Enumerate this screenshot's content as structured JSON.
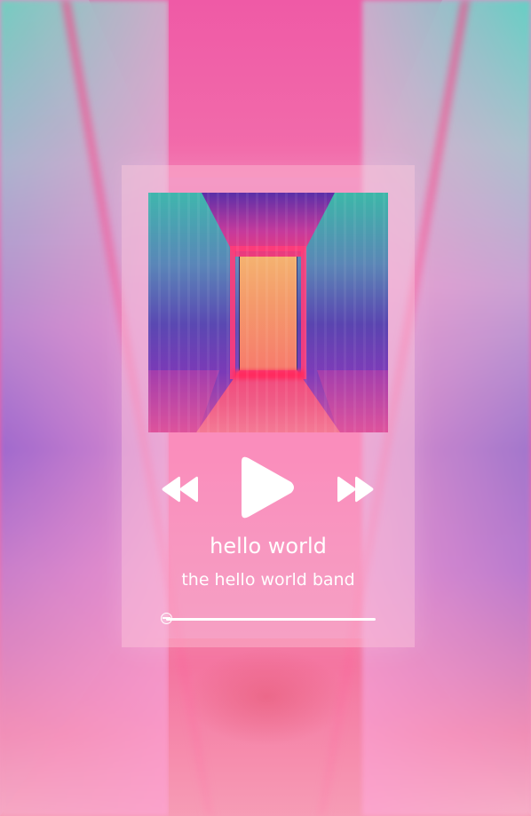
{
  "track": {
    "title": "hello world",
    "artist": "the hello world band"
  },
  "controls": {
    "previous_icon": "rewind-icon",
    "play_icon": "play-icon",
    "next_icon": "fast-forward-icon"
  },
  "progress": {
    "fraction": 0.0
  },
  "colors": {
    "text": "#ffffff",
    "card_overlay": "rgba(255,210,225,0.42)",
    "accent_pink": "#f15fa5"
  }
}
